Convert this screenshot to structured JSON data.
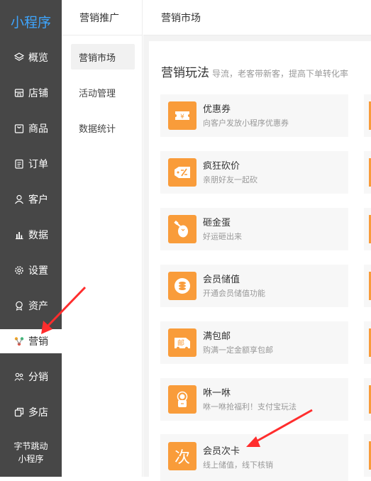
{
  "app": {
    "title": "小程序"
  },
  "nav": {
    "items": [
      {
        "label": "概览",
        "icon": "layers-icon"
      },
      {
        "label": "店铺",
        "icon": "store-icon"
      },
      {
        "label": "商品",
        "icon": "bag-icon"
      },
      {
        "label": "订单",
        "icon": "clipboard-icon"
      },
      {
        "label": "客户",
        "icon": "user-icon"
      },
      {
        "label": "数据",
        "icon": "bar-chart-icon"
      },
      {
        "label": "设置",
        "icon": "gear-icon"
      },
      {
        "label": "资产",
        "icon": "badge-icon"
      },
      {
        "label": "营销",
        "icon": "marketing-icon",
        "active": true
      },
      {
        "label": "分销",
        "icon": "distribution-icon"
      },
      {
        "label": "多店",
        "icon": "multi-store-icon"
      }
    ],
    "bottom_item": {
      "line1": "字节跳动",
      "line2": "小程序"
    }
  },
  "sub": {
    "header": "营销推广",
    "items": [
      "营销市场",
      "活动管理",
      "数据统计"
    ],
    "active_index": 0
  },
  "main": {
    "header": "营销市场",
    "section_title": "营销玩法",
    "section_subtitle": "导流，老客带新客，提高下单转化率",
    "cards": [
      {
        "title": "优惠券",
        "desc": "向客户发放小程序优惠券",
        "icon": "coupon-icon"
      },
      {
        "title": "疯狂砍价",
        "desc": "亲朋好友一起砍",
        "icon": "bargain-icon"
      },
      {
        "title": "砸金蛋",
        "desc": "好运砸出来",
        "icon": "golden-egg-icon"
      },
      {
        "title": "会员储值",
        "desc": "开通会员储值功能",
        "icon": "coins-icon"
      },
      {
        "title": "满包邮",
        "desc": "购满一定金额享包邮",
        "icon": "free-shipping-icon",
        "icon_text": "邮"
      },
      {
        "title": "咻一咻",
        "desc": "咻一咻抢福利！支付宝玩法",
        "icon": "tap-icon"
      },
      {
        "title": "会员次卡",
        "desc": "线上储值，线下核销",
        "icon": "times-card-icon",
        "icon_text": "次"
      }
    ]
  },
  "colors": {
    "nav_bg": "#474747",
    "brand_blue": "#3ea6ff",
    "icon_orange": "#f99c3a",
    "arrow_red": "#ff2d2d"
  }
}
